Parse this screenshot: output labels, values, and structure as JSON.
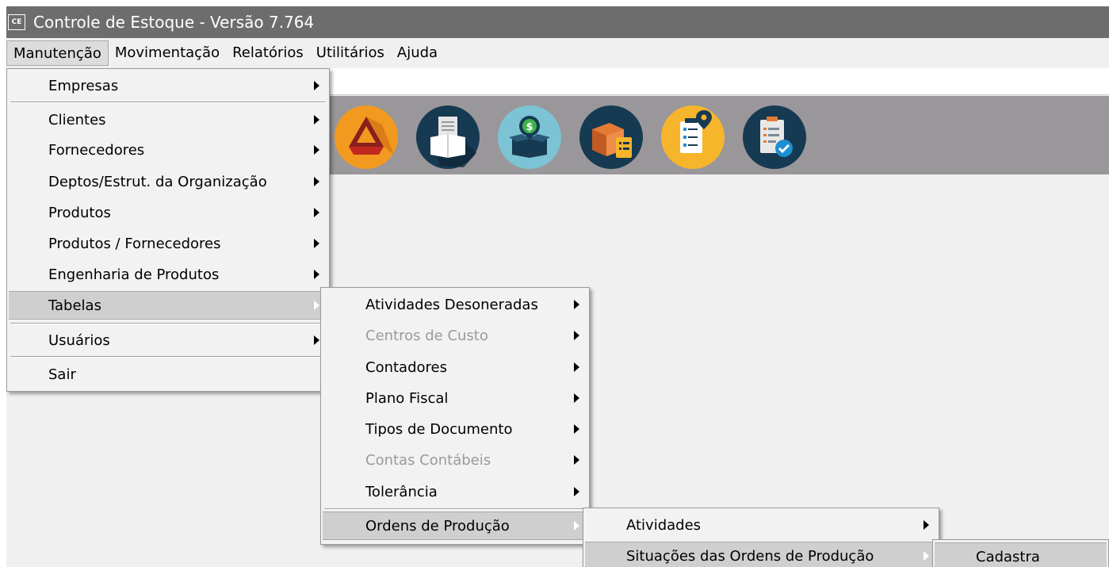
{
  "window": {
    "icon_text": "CE",
    "title": "Controle de Estoque - Versão 7.764"
  },
  "menubar": [
    "Manutenção",
    "Movimentação",
    "Relatórios",
    "Utilitários",
    "Ajuda"
  ],
  "toolbar_icons": [
    "drive-icon",
    "document-box-icon",
    "money-box-icon",
    "box-checklist-icon",
    "location-checklist-icon",
    "checklist-ok-icon"
  ],
  "colors": {
    "titlebar": "#6d6d6d",
    "toolbar": "#9a979b",
    "icon_orange": "#f29a1f",
    "icon_yellow": "#f7b52b",
    "icon_navy": "#163a52",
    "icon_teal": "#7cc4d5"
  },
  "menus": {
    "manutencao": [
      "Empresas",
      "Clientes",
      "Fornecedores",
      "Deptos/Estrut. da Organização",
      "Produtos",
      "Produtos / Fornecedores",
      "Engenharia de Produtos",
      "Tabelas",
      "Usuários",
      "Sair"
    ],
    "tabelas": [
      "Atividades Desoneradas",
      "Centros de Custo",
      "Contadores",
      "Plano Fiscal",
      "Tipos de Documento",
      "Contas Contábeis",
      "Tolerância",
      "Ordens de Produção"
    ],
    "ordens_producao": [
      "Atividades",
      "Situações das Ordens de Produção"
    ],
    "situacoes": [
      "Cadastra"
    ]
  }
}
